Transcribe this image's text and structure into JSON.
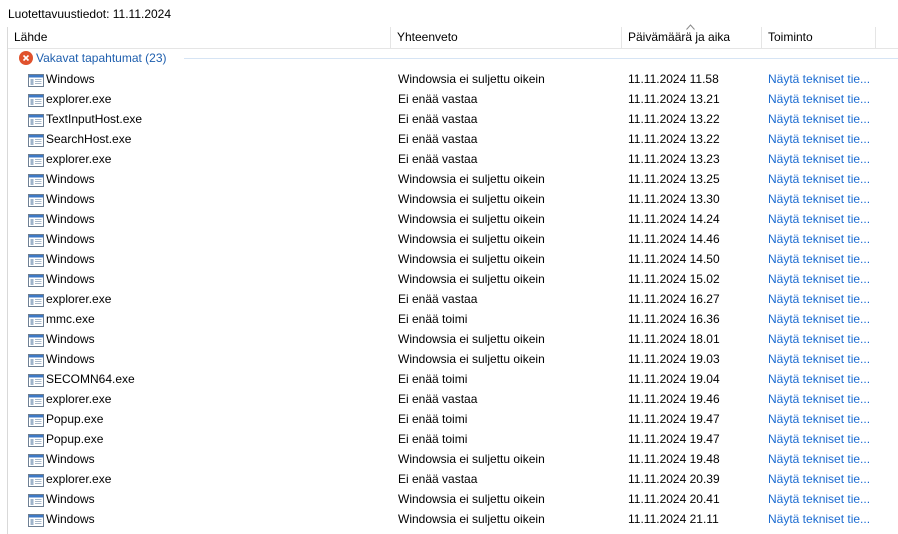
{
  "report_title": "Luotettavuustiedot: 11.11.2024",
  "columns": {
    "source": "Lähde",
    "summary": "Yhteenveto",
    "date": "Päivämäärä ja aika",
    "action": "Toiminto"
  },
  "group": {
    "label": "Vakavat tapahtumat (23)"
  },
  "rows": [
    {
      "source": "Windows",
      "summary": "Windowsia ei suljettu oikein",
      "date": "11.11.2024 11.58",
      "action": "Näytä tekniset tie..."
    },
    {
      "source": "explorer.exe",
      "summary": "Ei enää vastaa",
      "date": "11.11.2024 13.21",
      "action": "Näytä tekniset tie..."
    },
    {
      "source": "TextInputHost.exe",
      "summary": "Ei enää vastaa",
      "date": "11.11.2024 13.22",
      "action": "Näytä tekniset tie..."
    },
    {
      "source": "SearchHost.exe",
      "summary": "Ei enää vastaa",
      "date": "11.11.2024 13.22",
      "action": "Näytä tekniset tie..."
    },
    {
      "source": "explorer.exe",
      "summary": "Ei enää vastaa",
      "date": "11.11.2024 13.23",
      "action": "Näytä tekniset tie..."
    },
    {
      "source": "Windows",
      "summary": "Windowsia ei suljettu oikein",
      "date": "11.11.2024 13.25",
      "action": "Näytä tekniset tie..."
    },
    {
      "source": "Windows",
      "summary": "Windowsia ei suljettu oikein",
      "date": "11.11.2024 13.30",
      "action": "Näytä tekniset tie..."
    },
    {
      "source": "Windows",
      "summary": "Windowsia ei suljettu oikein",
      "date": "11.11.2024 14.24",
      "action": "Näytä tekniset tie..."
    },
    {
      "source": "Windows",
      "summary": "Windowsia ei suljettu oikein",
      "date": "11.11.2024 14.46",
      "action": "Näytä tekniset tie..."
    },
    {
      "source": "Windows",
      "summary": "Windowsia ei suljettu oikein",
      "date": "11.11.2024 14.50",
      "action": "Näytä tekniset tie..."
    },
    {
      "source": "Windows",
      "summary": "Windowsia ei suljettu oikein",
      "date": "11.11.2024 15.02",
      "action": "Näytä tekniset tie..."
    },
    {
      "source": "explorer.exe",
      "summary": "Ei enää vastaa",
      "date": "11.11.2024 16.27",
      "action": "Näytä tekniset tie..."
    },
    {
      "source": "mmc.exe",
      "summary": "Ei enää toimi",
      "date": "11.11.2024 16.36",
      "action": "Näytä tekniset tie..."
    },
    {
      "source": "Windows",
      "summary": "Windowsia ei suljettu oikein",
      "date": "11.11.2024 18.01",
      "action": "Näytä tekniset tie..."
    },
    {
      "source": "Windows",
      "summary": "Windowsia ei suljettu oikein",
      "date": "11.11.2024 19.03",
      "action": "Näytä tekniset tie..."
    },
    {
      "source": "SECOMN64.exe",
      "summary": "Ei enää toimi",
      "date": "11.11.2024 19.04",
      "action": "Näytä tekniset tie..."
    },
    {
      "source": "explorer.exe",
      "summary": "Ei enää vastaa",
      "date": "11.11.2024 19.46",
      "action": "Näytä tekniset tie..."
    },
    {
      "source": "Popup.exe",
      "summary": "Ei enää toimi",
      "date": "11.11.2024 19.47",
      "action": "Näytä tekniset tie..."
    },
    {
      "source": "Popup.exe",
      "summary": "Ei enää toimi",
      "date": "11.11.2024 19.47",
      "action": "Näytä tekniset tie..."
    },
    {
      "source": "Windows",
      "summary": "Windowsia ei suljettu oikein",
      "date": "11.11.2024 19.48",
      "action": "Näytä tekniset tie..."
    },
    {
      "source": "explorer.exe",
      "summary": "Ei enää vastaa",
      "date": "11.11.2024 20.39",
      "action": "Näytä tekniset tie..."
    },
    {
      "source": "Windows",
      "summary": "Windowsia ei suljettu oikein",
      "date": "11.11.2024 20.41",
      "action": "Näytä tekniset tie..."
    },
    {
      "source": "Windows",
      "summary": "Windowsia ei suljettu oikein",
      "date": "11.11.2024 21.11",
      "action": "Näytä tekniset tie..."
    }
  ],
  "icons": {
    "row": "application-window-icon",
    "group": "error-icon",
    "sort": "sort-arrow-icon"
  },
  "colors": {
    "link": "#1a6bd1",
    "group_label": "#1f5fae",
    "error": "#e0522d"
  }
}
